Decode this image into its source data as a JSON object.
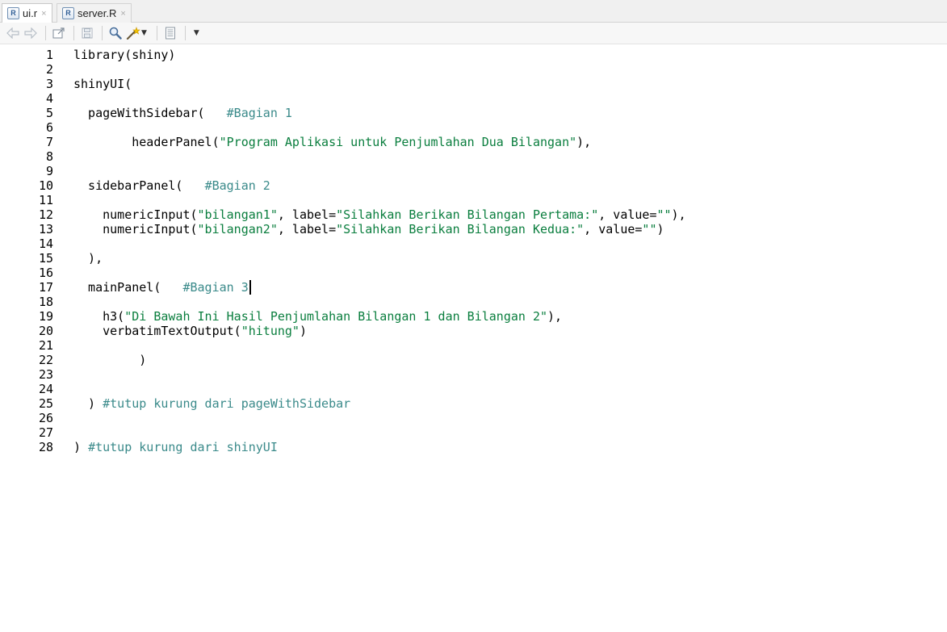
{
  "tabs": [
    {
      "label": "ui.r",
      "active": true
    },
    {
      "label": "server.R",
      "active": false
    }
  ],
  "icons": {
    "tab_file": "r-file-icon",
    "tab_close": "close-icon",
    "back": "back-arrow-icon",
    "forward": "forward-arrow-icon",
    "show_window": "show-in-window-icon",
    "save": "save-icon",
    "find": "search-icon",
    "code_tools": "magic-wand-icon",
    "compile": "notebook-icon",
    "more": "chevron-down-icon"
  },
  "tab_close_glyph": "×",
  "colors": {
    "string": "#0a7e3e",
    "comment": "#3a8a8a",
    "text": "#000000",
    "line_number": "#000000"
  },
  "editor": {
    "lines": [
      {
        "num": "1",
        "code": "library(shiny)"
      },
      {
        "num": "2",
        "code": ""
      },
      {
        "num": "3",
        "code": "shinyUI("
      },
      {
        "num": "4",
        "code": ""
      },
      {
        "num": "5",
        "code": "  pageWithSidebar(   #Bagian 1"
      },
      {
        "num": "6",
        "code": ""
      },
      {
        "num": "7",
        "code": "        headerPanel(\"Program Aplikasi untuk Penjumlahan Dua Bilangan\"),"
      },
      {
        "num": "8",
        "code": ""
      },
      {
        "num": "9",
        "code": ""
      },
      {
        "num": "10",
        "code": "  sidebarPanel(   #Bagian 2"
      },
      {
        "num": "11",
        "code": ""
      },
      {
        "num": "12",
        "code": "    numericInput(\"bilangan1\", label=\"Silahkan Berikan Bilangan Pertama:\", value=\"\"),"
      },
      {
        "num": "13",
        "code": "    numericInput(\"bilangan2\", label=\"Silahkan Berikan Bilangan Kedua:\", value=\"\")"
      },
      {
        "num": "14",
        "code": ""
      },
      {
        "num": "15",
        "code": "  ),"
      },
      {
        "num": "16",
        "code": ""
      },
      {
        "num": "17",
        "code": "  mainPanel(   #Bagian 3"
      },
      {
        "num": "18",
        "code": ""
      },
      {
        "num": "19",
        "code": "    h3(\"Di Bawah Ini Hasil Penjumlahan Bilangan 1 dan Bilangan 2\"),"
      },
      {
        "num": "20",
        "code": "    verbatimTextOutput(\"hitung\")"
      },
      {
        "num": "21",
        "code": ""
      },
      {
        "num": "22",
        "code": "         )"
      },
      {
        "num": "23",
        "code": ""
      },
      {
        "num": "24",
        "code": ""
      },
      {
        "num": "25",
        "code": "  ) #tutup kurung dari pageWithSidebar"
      },
      {
        "num": "26",
        "code": ""
      },
      {
        "num": "27",
        "code": ""
      },
      {
        "num": "28",
        "code": ") #tutup kurung dari shinyUI"
      }
    ],
    "cursor_line": "17"
  }
}
